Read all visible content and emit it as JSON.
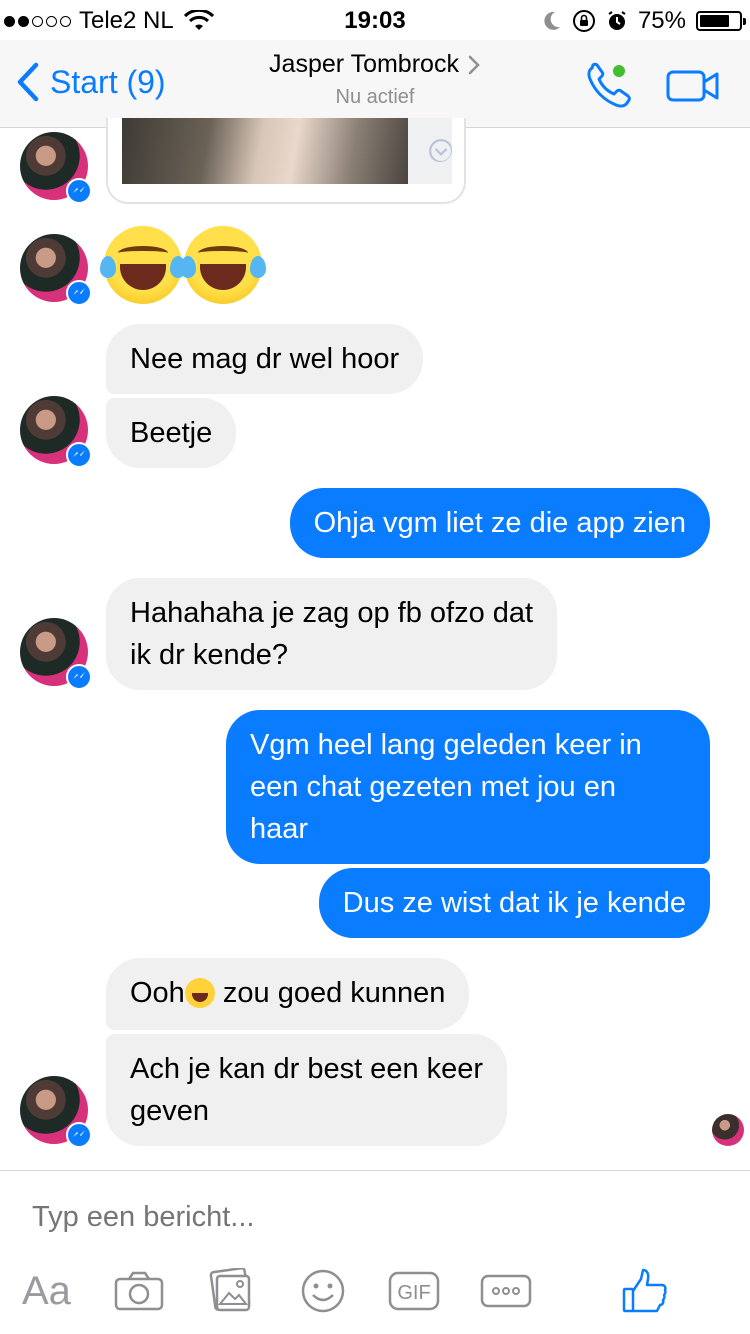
{
  "status_bar": {
    "carrier": "Tele2 NL",
    "time": "19:03",
    "battery_percent": "75%",
    "battery_level": 0.75
  },
  "nav": {
    "back_label": "Start (9)",
    "contact_name": "Jasper Tombrock",
    "contact_status": "Nu actief",
    "online_color": "#44bd32"
  },
  "messages": [
    {
      "id": "m1",
      "from": "them",
      "type": "text",
      "text": "Nee mag dr wel hoor"
    },
    {
      "id": "m2",
      "from": "them",
      "type": "text",
      "text": "Beetje"
    },
    {
      "id": "m3",
      "from": "me",
      "type": "text",
      "text": "Ohja vgm liet ze die app zien"
    },
    {
      "id": "m4",
      "from": "them",
      "type": "text",
      "lines": [
        "Hahahaha je zag op fb ofzo dat",
        "ik dr kende?"
      ]
    },
    {
      "id": "m5",
      "from": "me",
      "type": "text",
      "lines": [
        "Vgm heel lang geleden keer in",
        "een chat gezeten met jou en",
        "haar"
      ]
    },
    {
      "id": "m6",
      "from": "me",
      "type": "text",
      "text": "Dus ze wist dat ik je kende"
    },
    {
      "id": "m7",
      "from": "them",
      "type": "text",
      "text_before": "Ooh",
      "text_after": " zou goed kunnen"
    },
    {
      "id": "m8",
      "from": "them",
      "type": "text",
      "lines": [
        "Ach je kan dr best een keer",
        "geven"
      ]
    }
  ],
  "composer": {
    "placeholder": "Typ een bericht...",
    "aa_label": "Aa",
    "gif_label": "GIF"
  },
  "colors": {
    "accent": "#0a7cff",
    "incoming_bubble": "#f1f0f0",
    "outgoing_bubble": "#0a7cff",
    "toolbar_icon": "#8e8e93"
  }
}
